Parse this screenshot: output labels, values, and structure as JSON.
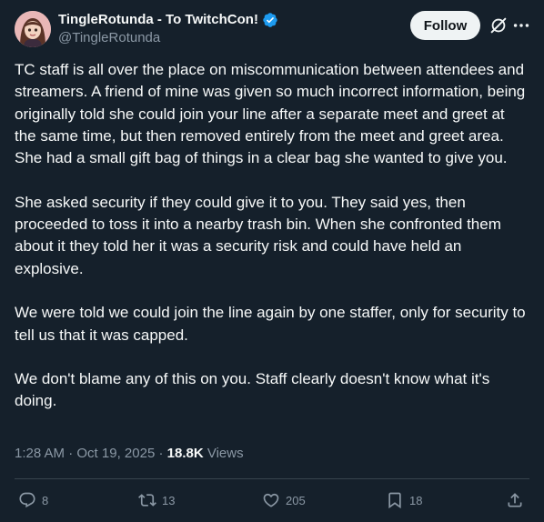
{
  "author": {
    "display_name": "TingleRotunda - To TwitchCon!",
    "handle": "@TingleRotunda",
    "verified": true
  },
  "header": {
    "follow_label": "Follow",
    "icons": [
      "grok-icon",
      "more-icon"
    ]
  },
  "tweet": {
    "paragraphs": [
      "TC staff is all over the place on miscommunication between attendees and streamers. A friend of mine was given so much incorrect information, being originally told she could join your line after a separate meet and greet at the same time, but then removed entirely from the meet and greet area. She had a small gift bag of things in a clear bag she wanted to give you.",
      "She asked security if they could give it to you. They said yes, then proceeded to toss it into a nearby trash bin. When she confronted them about it they told her it was a security risk and could have held an explosive.",
      "We were told we could join the line again by one staffer, only for security to tell us that it was capped.",
      "We don't blame any of this on you. Staff clearly doesn't know what it's doing."
    ],
    "time": "1:28 AM",
    "date": "Oct 19, 2025",
    "views_count": "18.8K",
    "views_label": "Views",
    "separator": " · "
  },
  "stats": {
    "replies": "8",
    "reposts": "13",
    "likes": "205",
    "bookmarks": "18"
  },
  "colors": {
    "background": "#15202b",
    "text": "#f7f9f9",
    "secondary": "#8b98a5",
    "divider": "#38444d",
    "verified": "#1d9bf0",
    "follow_bg": "#eff3f4"
  }
}
